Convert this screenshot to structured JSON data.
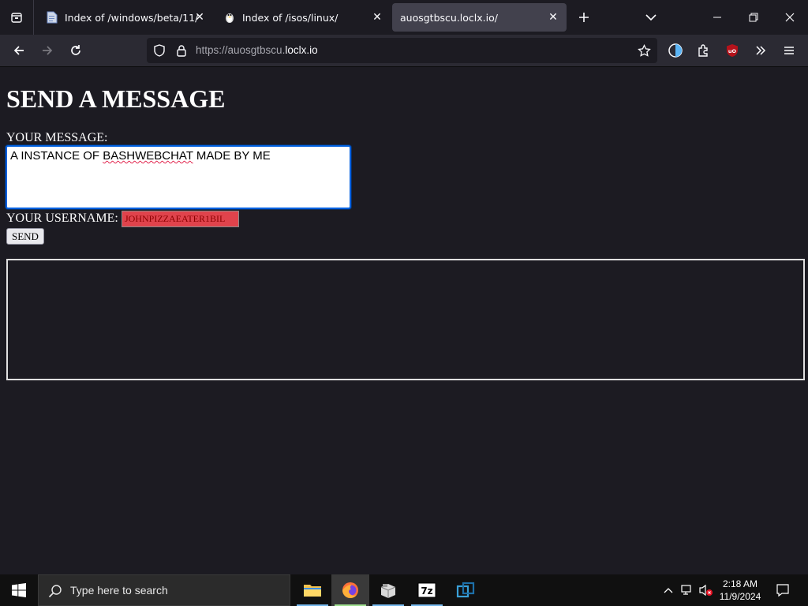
{
  "browser": {
    "tabs": [
      {
        "title": "Index of /windows/beta/11/",
        "active": false
      },
      {
        "title": "Index of /isos/linux/",
        "active": false
      },
      {
        "title": "auosgtbscu.loclx.io/",
        "active": true
      }
    ],
    "url_prefix": "https://auosgtbscu.",
    "url_domain": "loclx.io",
    "accent": "#0060df"
  },
  "page": {
    "heading": "SEND A MESSAGE",
    "message_label": "YOUR MESSAGE:",
    "message_value_a": "A INSTANCE OF ",
    "message_value_b": "BASHWEBCHAT",
    "message_value_c": " MADE BY ME",
    "username_label": "YOUR USERNAME:",
    "username_value": "JOHNPIZZAEATER1BIL",
    "send_label": "SEND"
  },
  "taskbar": {
    "search_placeholder": "Type here to search",
    "apps": [
      "file-explorer-icon",
      "firefox-icon",
      "package-icon",
      "7zip-icon",
      "virtualbox-icon"
    ],
    "time": "2:18 AM",
    "date": "11/9/2024"
  }
}
